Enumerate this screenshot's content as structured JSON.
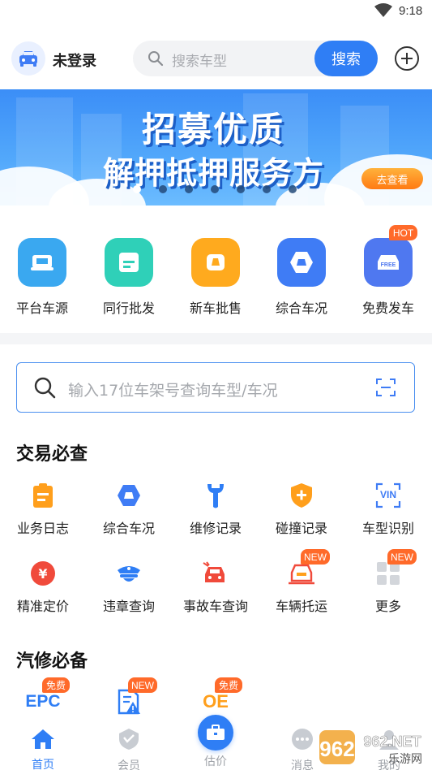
{
  "status": {
    "time": "9:18"
  },
  "header": {
    "login_label": "未登录",
    "search_placeholder": "搜索车型",
    "search_button": "搜索"
  },
  "banner": {
    "line1": "招募优质",
    "line2": "解押抵押服务方",
    "cta": "去查看",
    "dots_total": 7,
    "active_dot": 0
  },
  "quick_entries": [
    {
      "label": "平台车源",
      "icon": "car-source-icon",
      "color": "#3aa8f0"
    },
    {
      "label": "同行批发",
      "icon": "wholesale-icon",
      "color": "#2fd0b8"
    },
    {
      "label": "新车批售",
      "icon": "new-car-icon",
      "color": "#ffaa1e"
    },
    {
      "label": "综合车况",
      "icon": "car-condition-icon",
      "color": "#3f7cf5"
    },
    {
      "label": "免费发车",
      "icon": "free-post-icon",
      "color": "#4f78f0",
      "badge": "HOT"
    }
  ],
  "vin_search": {
    "placeholder": "输入17位车架号查询车型/车况"
  },
  "trade_section": {
    "title": "交易必查",
    "items": [
      {
        "label": "业务日志",
        "icon": "business-log-icon"
      },
      {
        "label": "综合车况",
        "icon": "car-condition-icon"
      },
      {
        "label": "维修记录",
        "icon": "repair-record-icon"
      },
      {
        "label": "碰撞记录",
        "icon": "collision-record-icon"
      },
      {
        "label": "车型识别",
        "icon": "vin-recognition-icon",
        "glyph": "VIN"
      },
      {
        "label": "精准定价",
        "icon": "pricing-icon",
        "glyph": "¥"
      },
      {
        "label": "违章查询",
        "icon": "violation-query-icon"
      },
      {
        "label": "事故车查询",
        "icon": "accident-car-icon"
      },
      {
        "label": "车辆托运",
        "icon": "vehicle-shipping-icon",
        "badge": "NEW"
      },
      {
        "label": "更多",
        "icon": "more-grid-icon",
        "badge": "NEW"
      }
    ]
  },
  "repair_section": {
    "title": "汽修必备",
    "items": [
      {
        "glyph": "EPC",
        "badge": "免费"
      },
      {
        "badge": "NEW"
      },
      {
        "glyph": "OE",
        "badge": "免费"
      }
    ]
  },
  "tabbar": {
    "tabs": [
      {
        "label": "首页",
        "active": true
      },
      {
        "label": "会员"
      },
      {
        "label": "估价"
      },
      {
        "label": "消息"
      },
      {
        "label": "我的"
      }
    ]
  },
  "watermark": {
    "text": "962.NET",
    "sub": "乐游网"
  },
  "colors": {
    "primary": "#2f7ef5",
    "badge": "#ff6a2a"
  }
}
